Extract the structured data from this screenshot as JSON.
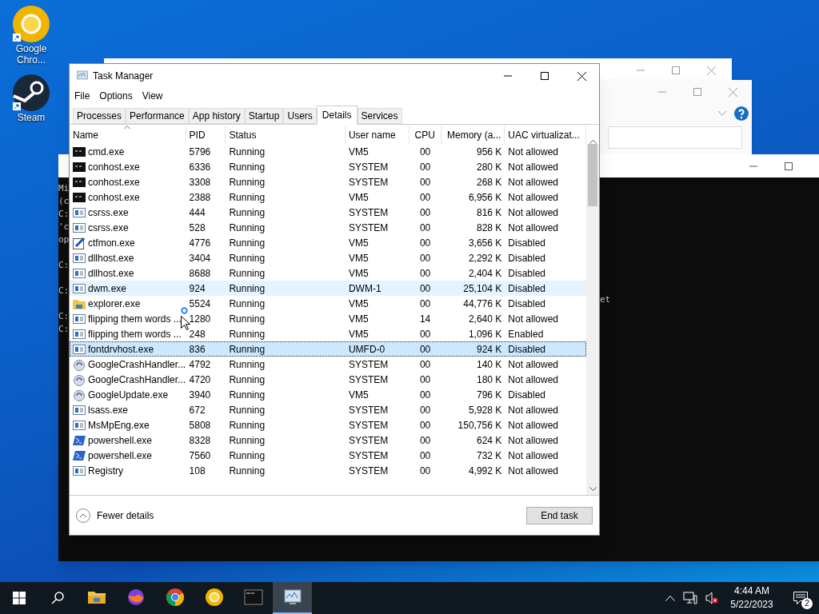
{
  "desktop_icons": [
    {
      "label": "Google Chro...",
      "kind": "ring"
    },
    {
      "label": "Steam",
      "kind": "steam"
    }
  ],
  "console_window": {
    "fragments": [
      "Mi",
      "(c",
      "C:",
      "'c",
      "op",
      "C:",
      "C:",
      "C:",
      "C:"
    ],
    "right_fragment": "et"
  },
  "task_manager": {
    "title": "Task Manager",
    "menu": [
      "File",
      "Options",
      "View"
    ],
    "tabs": [
      {
        "label": "Processes",
        "selected": false
      },
      {
        "label": "Performance",
        "selected": false
      },
      {
        "label": "App history",
        "selected": false
      },
      {
        "label": "Startup",
        "selected": false
      },
      {
        "label": "Users",
        "selected": false
      },
      {
        "label": "Details",
        "selected": true
      },
      {
        "label": "Services",
        "selected": false
      }
    ],
    "columns": [
      "Name",
      "PID",
      "Status",
      "User name",
      "CPU",
      "Memory (a...",
      "UAC virtualizat..."
    ],
    "rows": [
      {
        "kind": "console",
        "name": "cmd.exe",
        "pid": "5796",
        "status": "Running",
        "user": "VM5",
        "cpu": "00",
        "memory": "956 K",
        "uac": "Not allowed",
        "selected": false,
        "hot": false
      },
      {
        "kind": "console",
        "name": "conhost.exe",
        "pid": "6336",
        "status": "Running",
        "user": "SYSTEM",
        "cpu": "00",
        "memory": "280 K",
        "uac": "Not allowed",
        "selected": false,
        "hot": false
      },
      {
        "kind": "console",
        "name": "conhost.exe",
        "pid": "3308",
        "status": "Running",
        "user": "SYSTEM",
        "cpu": "00",
        "memory": "268 K",
        "uac": "Not allowed",
        "selected": false,
        "hot": false
      },
      {
        "kind": "console",
        "name": "conhost.exe",
        "pid": "2388",
        "status": "Running",
        "user": "VM5",
        "cpu": "00",
        "memory": "6,956 K",
        "uac": "Not allowed",
        "selected": false,
        "hot": false
      },
      {
        "kind": "app",
        "name": "csrss.exe",
        "pid": "444",
        "status": "Running",
        "user": "SYSTEM",
        "cpu": "00",
        "memory": "816 K",
        "uac": "Not allowed",
        "selected": false,
        "hot": false
      },
      {
        "kind": "app",
        "name": "csrss.exe",
        "pid": "528",
        "status": "Running",
        "user": "SYSTEM",
        "cpu": "00",
        "memory": "828 K",
        "uac": "Not allowed",
        "selected": false,
        "hot": false
      },
      {
        "kind": "pen",
        "name": "ctfmon.exe",
        "pid": "4776",
        "status": "Running",
        "user": "VM5",
        "cpu": "00",
        "memory": "3,656 K",
        "uac": "Disabled",
        "selected": false,
        "hot": false
      },
      {
        "kind": "app",
        "name": "dllhost.exe",
        "pid": "3404",
        "status": "Running",
        "user": "VM5",
        "cpu": "00",
        "memory": "2,292 K",
        "uac": "Disabled",
        "selected": false,
        "hot": false
      },
      {
        "kind": "app",
        "name": "dllhost.exe",
        "pid": "8688",
        "status": "Running",
        "user": "VM5",
        "cpu": "00",
        "memory": "2,404 K",
        "uac": "Disabled",
        "selected": false,
        "hot": false
      },
      {
        "kind": "app",
        "name": "dwm.exe",
        "pid": "924",
        "status": "Running",
        "user": "DWM-1",
        "cpu": "00",
        "memory": "25,104 K",
        "uac": "Disabled",
        "selected": false,
        "hot": true
      },
      {
        "kind": "folder",
        "name": "explorer.exe",
        "pid": "5524",
        "status": "Running",
        "user": "VM5",
        "cpu": "00",
        "memory": "44,776 K",
        "uac": "Disabled",
        "selected": false,
        "hot": false
      },
      {
        "kind": "app",
        "name": "flipping them words ...",
        "pid": "1280",
        "status": "Running",
        "user": "VM5",
        "cpu": "14",
        "memory": "2,640 K",
        "uac": "Not allowed",
        "selected": false,
        "hot": false
      },
      {
        "kind": "app",
        "name": "flipping them words ...",
        "pid": "248",
        "status": "Running",
        "user": "VM5",
        "cpu": "00",
        "memory": "1,096 K",
        "uac": "Enabled",
        "selected": false,
        "hot": false
      },
      {
        "kind": "app",
        "name": "fontdrvhost.exe",
        "pid": "836",
        "status": "Running",
        "user": "UMFD-0",
        "cpu": "00",
        "memory": "924 K",
        "uac": "Disabled",
        "selected": true,
        "hot": false
      },
      {
        "kind": "update",
        "name": "GoogleCrashHandler...",
        "pid": "4792",
        "status": "Running",
        "user": "SYSTEM",
        "cpu": "00",
        "memory": "140 K",
        "uac": "Not allowed",
        "selected": false,
        "hot": false
      },
      {
        "kind": "update",
        "name": "GoogleCrashHandler...",
        "pid": "4720",
        "status": "Running",
        "user": "SYSTEM",
        "cpu": "00",
        "memory": "180 K",
        "uac": "Not allowed",
        "selected": false,
        "hot": false
      },
      {
        "kind": "update",
        "name": "GoogleUpdate.exe",
        "pid": "3940",
        "status": "Running",
        "user": "VM5",
        "cpu": "00",
        "memory": "796 K",
        "uac": "Disabled",
        "selected": false,
        "hot": false
      },
      {
        "kind": "app",
        "name": "lsass.exe",
        "pid": "672",
        "status": "Running",
        "user": "SYSTEM",
        "cpu": "00",
        "memory": "5,928 K",
        "uac": "Not allowed",
        "selected": false,
        "hot": false
      },
      {
        "kind": "app",
        "name": "MsMpEng.exe",
        "pid": "5808",
        "status": "Running",
        "user": "SYSTEM",
        "cpu": "00",
        "memory": "150,756 K",
        "uac": "Not allowed",
        "selected": false,
        "hot": false
      },
      {
        "kind": "shell",
        "name": "powershell.exe",
        "pid": "8328",
        "status": "Running",
        "user": "SYSTEM",
        "cpu": "00",
        "memory": "624 K",
        "uac": "Not allowed",
        "selected": false,
        "hot": false
      },
      {
        "kind": "shell",
        "name": "powershell.exe",
        "pid": "7560",
        "status": "Running",
        "user": "SYSTEM",
        "cpu": "00",
        "memory": "732 K",
        "uac": "Not allowed",
        "selected": false,
        "hot": false
      },
      {
        "kind": "app",
        "name": "Registry",
        "pid": "108",
        "status": "Running",
        "user": "SYSTEM",
        "cpu": "00",
        "memory": "4,992 K",
        "uac": "Not allowed",
        "selected": false,
        "hot": false
      }
    ],
    "fewer_details": "Fewer details",
    "end_task": "End task"
  },
  "taskbar": {
    "apps": [
      {
        "kind": "folder",
        "active": false
      },
      {
        "kind": "fox",
        "active": false
      },
      {
        "kind": "chrome",
        "active": false
      },
      {
        "kind": "ring",
        "active": false
      },
      {
        "kind": "console",
        "active": false
      },
      {
        "kind": "monitor",
        "active": true
      }
    ],
    "time": "4:44 AM",
    "date": "5/22/2023",
    "notifications": "2"
  }
}
